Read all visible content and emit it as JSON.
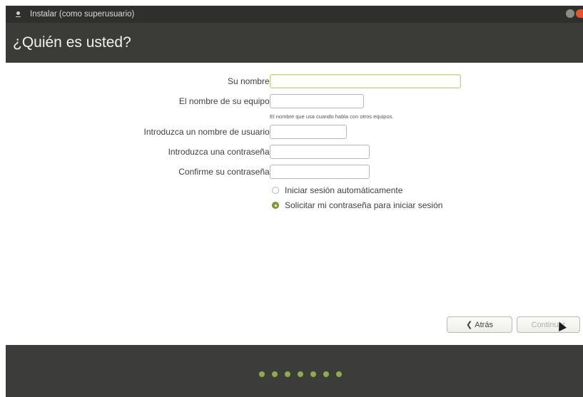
{
  "window": {
    "title": "Instalar (como superusuario)"
  },
  "page": {
    "title": "¿Quién es usted?"
  },
  "form": {
    "name": {
      "label": "Su nombre:",
      "value": ""
    },
    "computer": {
      "label": "El nombre de su equipo:",
      "value": "",
      "hint": "El nombre que usa cuando habla con otros equipos."
    },
    "username": {
      "label": "Introduzca un nombre de usuario:",
      "value": ""
    },
    "password": {
      "label": "Introduzca una contraseña:",
      "value": ""
    },
    "confirm": {
      "label": "Confirme su contraseña:",
      "value": ""
    },
    "login_options": [
      {
        "label": "Iniciar sesión automáticamente",
        "selected": false
      },
      {
        "label": "Solicitar mi contraseña para iniciar sesión",
        "selected": true
      }
    ]
  },
  "buttons": {
    "back": "Atrás",
    "continue": "Continuar"
  },
  "progress": {
    "total_steps": 7
  },
  "colors": {
    "accent": "#7aa035",
    "header": "#3b3b38",
    "footer": "#3c3c3a"
  },
  "icons": {
    "back": "chevron-left-icon",
    "window_menu": "window-menu-icon"
  }
}
